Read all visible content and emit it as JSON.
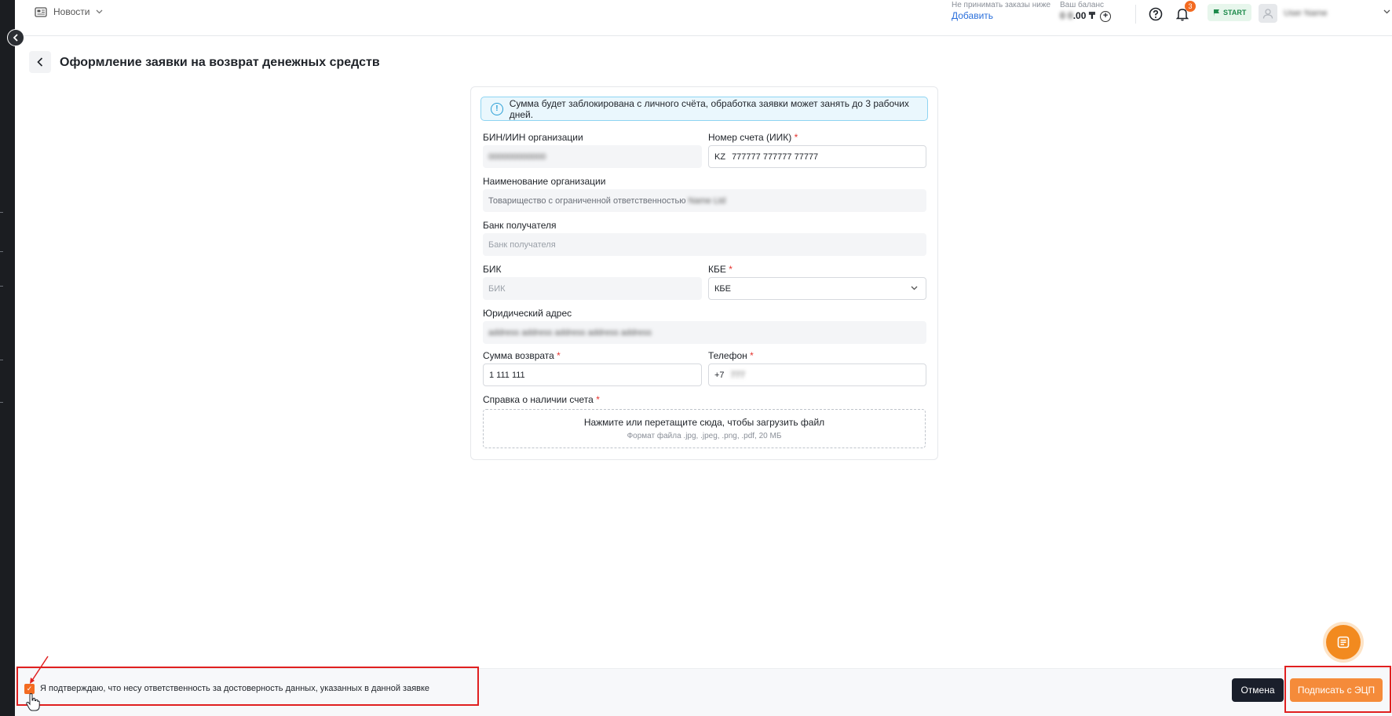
{
  "header": {
    "news_label": "Новости",
    "reject_label": "Не принимать заказы ниже",
    "add_link": "Добавить",
    "balance_label": "Ваш баланс",
    "balance_hidden": "0 0",
    "balance_tail": ".00 ₸",
    "notifications_count": "3",
    "plan_badge": "START",
    "user_name_hidden": "User Name"
  },
  "page": {
    "title": "Оформление заявки на возврат денежных средств"
  },
  "form": {
    "info_text": "Сумма будет заблокирована с личного счёта, обработка заявки может занять до 3 рабочих дней.",
    "bin_label": "БИН/ИИН организации",
    "bin_value_hidden": "000000000000",
    "account_label": "Номер счета (ИИК)",
    "account_prefix": "KZ",
    "account_value": "777777 777777 77777",
    "org_name_label": "Наименование организации",
    "org_name_value": "Товарищество с ограниченной ответственностью",
    "org_name_hidden": "Name Ltd",
    "bank_label": "Банк получателя",
    "bank_placeholder": "Банк получателя",
    "bik_label": "БИК",
    "bik_placeholder": "БИК",
    "kbe_label": "КБЕ",
    "kbe_value": "КБЕ",
    "address_label": "Юридический адрес",
    "address_hidden": "address address address address address",
    "amount_label": "Сумма возврата",
    "amount_value": "1 111 111",
    "phone_label": "Телефон",
    "phone_prefix": "+7",
    "phone_hidden": "777",
    "certificate_label": "Справка о наличии счета",
    "upload_title": "Нажмите или перетащите сюда, чтобы загрузить файл",
    "upload_hint": "Формат файла .jpg, .jpeg, .png, .pdf, 20 МБ",
    "required_mark": "*"
  },
  "footer": {
    "confirm_text": "Я подтверждаю, что несу ответственность за достоверность данных, указанных в данной заявке",
    "confirm_checked": true,
    "cancel_label": "Отмена",
    "sign_label": "Подписать с ЭЦП"
  },
  "colors": {
    "accent": "#f58b3a",
    "highlight_box": "#e02020",
    "info_border": "#8ed4f2"
  },
  "icons": [
    "newspaper-icon",
    "chevron-down-icon",
    "plus-circle-icon",
    "help-icon",
    "bell-icon",
    "flag-icon",
    "user-icon",
    "chevron-left-icon",
    "info-icon",
    "chat-icon",
    "hand-cursor-icon"
  ]
}
